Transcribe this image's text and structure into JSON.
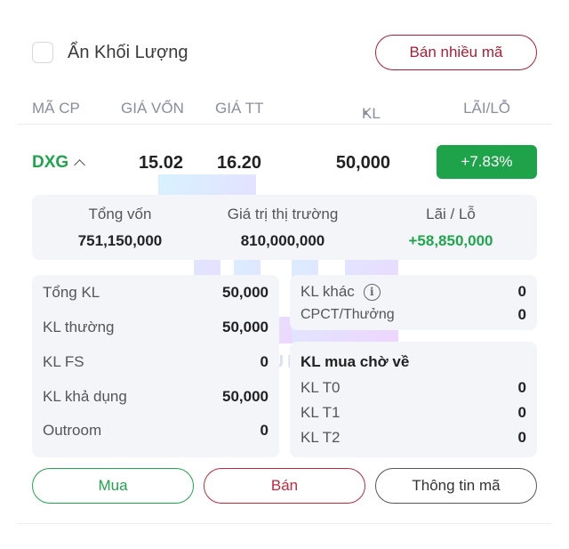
{
  "top": {
    "hide_volume_label": "Ẩn Khối Lượng",
    "sell_multi_label": "Bán nhiều mã"
  },
  "header": {
    "code": "MÃ CP",
    "cost": "GIÁ VỐN",
    "price": "GIÁ TT",
    "volume": "KL",
    "pnl": "LÃI/LỖ"
  },
  "position": {
    "ticker": "DXG",
    "cost_price": "15.02",
    "market_price": "16.20",
    "volume": "50,000",
    "pnl_pct": "+7.83%"
  },
  "summary": {
    "total_cost_label": "Tổng vốn",
    "total_cost": "751,150,000",
    "market_value_label": "Giá trị thị trường",
    "market_value": "810,000,000",
    "pnl_label": "Lãi / Lỗ",
    "pnl_value": "+58,850,000"
  },
  "details_left": [
    {
      "label": "Tổng KL",
      "value": "50,000"
    },
    {
      "label": "KL thường",
      "value": "50,000"
    },
    {
      "label": "KL FS",
      "value": "0"
    },
    {
      "label": "KL khả dụng",
      "value": "50,000"
    },
    {
      "label": "Outroom",
      "value": "0"
    }
  ],
  "details_right_top": [
    {
      "label": "KL khác",
      "value": "0"
    },
    {
      "label": "CPCT/Thưởng",
      "value": "0"
    }
  ],
  "pending": {
    "title": "KL mua chờ về",
    "rows": [
      {
        "label": "KL T0",
        "value": "0"
      },
      {
        "label": "KL T1",
        "value": "0"
      },
      {
        "label": "KL T2",
        "value": "0"
      }
    ]
  },
  "actions": {
    "buy": "Mua",
    "sell": "Bán",
    "info": "Thông tin mã"
  },
  "watermark": {
    "text": "TU LE GENUINE"
  },
  "colors": {
    "gain": "#1ea34a",
    "sell": "#c2283c",
    "panel_bg": "#f4f5f9"
  }
}
